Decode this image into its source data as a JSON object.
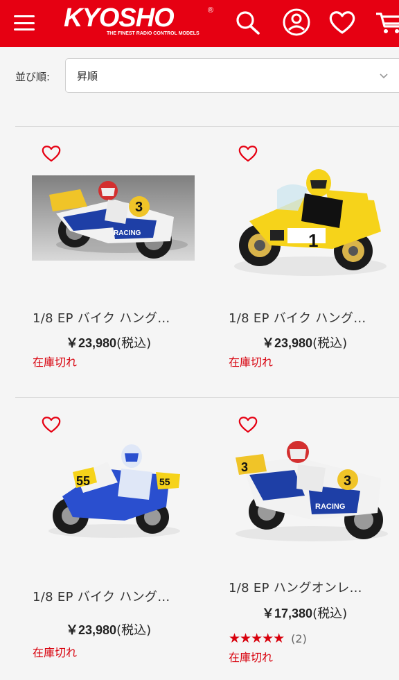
{
  "header": {
    "logo_text": "KYOSHO",
    "logo_registered": "®",
    "logo_tagline": "THE FINEST RADIO CONTROL MODELS",
    "icons": [
      "menu-icon",
      "search-icon",
      "account-icon",
      "heart-icon",
      "cart-icon"
    ],
    "brand_color": "#e60012"
  },
  "sort": {
    "label": "並び順:",
    "selected": "昇順"
  },
  "products": [
    {
      "title": "1/8 EP バイク ハング…",
      "price": "￥23,980",
      "tax": "(税込)",
      "stock": "在庫切れ",
      "image": "motorcycle-blue-white-3"
    },
    {
      "title": "1/8 EP バイク ハング…",
      "price": "￥23,980",
      "tax": "(税込)",
      "stock": "在庫切れ",
      "image": "motorcycle-yellow-1"
    },
    {
      "title": "1/8 EP バイク ハング…",
      "price": "￥23,980",
      "tax": "(税込)",
      "stock": "在庫切れ",
      "image": "motorcycle-blue-55"
    },
    {
      "title": "1/8 EP ハングオンレ…",
      "price": "￥17,380",
      "tax": "(税込)",
      "stock": "在庫切れ",
      "image": "motorcycle-blue-white-3",
      "rating": 5,
      "rating_count": "(2)"
    }
  ],
  "colors": {
    "accent": "#e60012",
    "stock_out": "#d8000c"
  }
}
